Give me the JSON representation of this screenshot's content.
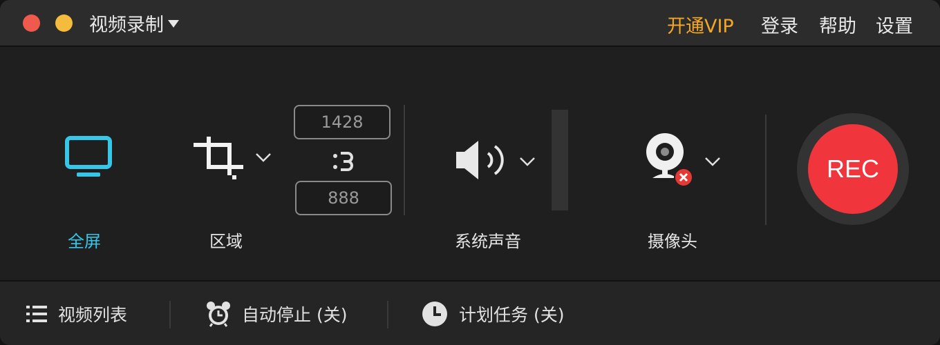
{
  "window": {
    "title": "视频录制"
  },
  "menu": {
    "vip": "开通VIP",
    "login": "登录",
    "help": "帮助",
    "settings": "设置"
  },
  "tools": {
    "fullscreen": {
      "label": "全屏",
      "icon": "monitor-icon"
    },
    "region": {
      "label": "区域",
      "icon": "crop-icon",
      "width": "1428",
      "height": "888"
    },
    "audio": {
      "label": "系统声音",
      "icon": "speaker-icon"
    },
    "camera": {
      "label": "摄像头",
      "icon": "webcam-icon",
      "status": "disabled"
    }
  },
  "record": {
    "label": "REC"
  },
  "bottom": {
    "video_list": "视频列表",
    "auto_stop": "自动停止 (关)",
    "scheduled_task": "计划任务 (关)"
  },
  "colors": {
    "accent": "#35c6e8",
    "vip": "#f5a623",
    "rec": "#f0353c",
    "close": "#f05a4d",
    "minimize": "#f4bb3c",
    "camera_off": "#e53935"
  }
}
